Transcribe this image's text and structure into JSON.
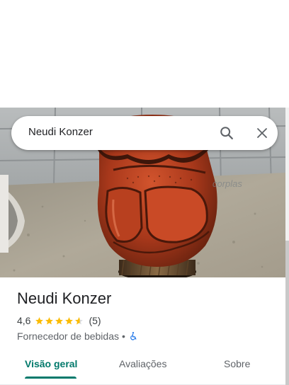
{
  "search": {
    "query": "Neudi Konzer"
  },
  "hero": {
    "watermark": "corplas"
  },
  "place": {
    "name": "Neudi Konzer",
    "rating": "4,6",
    "stars_value": 4.6,
    "review_count": "(5)",
    "category": "Fornecedor de bebidas",
    "separator": "•"
  },
  "tabs": [
    {
      "label": "Visão geral",
      "active": true
    },
    {
      "label": "Avaliações",
      "active": false
    },
    {
      "label": "Sobre",
      "active": false
    }
  ],
  "colors": {
    "accent": "#00796b",
    "star": "#fbbc04",
    "accessibility": "#1a73e8"
  }
}
